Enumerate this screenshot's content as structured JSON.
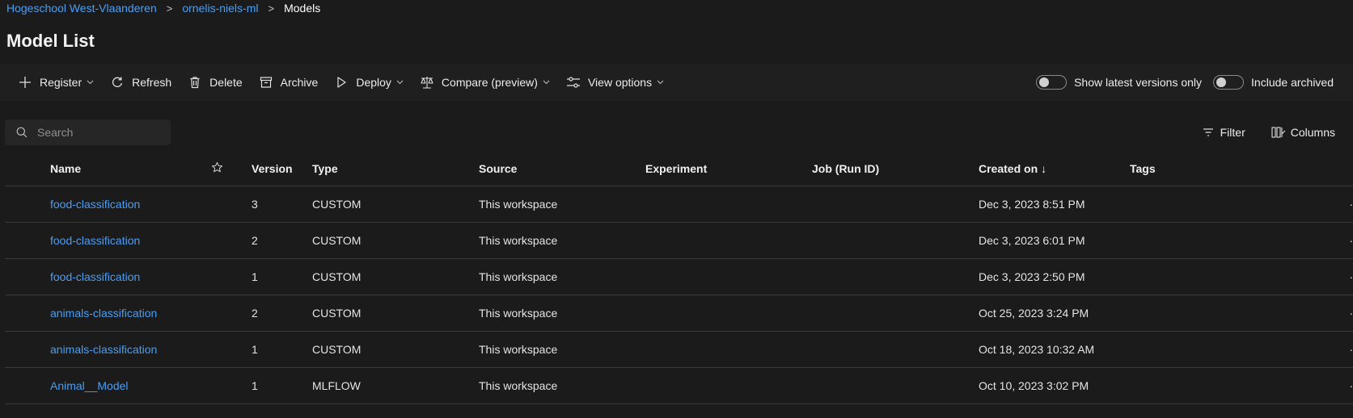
{
  "breadcrumb": {
    "items": [
      "Hogeschool West-Vlaanderen",
      "ornelis-niels-ml"
    ],
    "current": "Models",
    "separator": ">"
  },
  "page": {
    "title": "Model List"
  },
  "toolbar": {
    "register": "Register",
    "refresh": "Refresh",
    "delete": "Delete",
    "archive": "Archive",
    "deploy": "Deploy",
    "compare": "Compare (preview)",
    "view_options": "View options"
  },
  "toggles": {
    "latest_only": {
      "label": "Show latest versions only",
      "on": false
    },
    "include_archived": {
      "label": "Include archived",
      "on": false
    }
  },
  "search": {
    "placeholder": "Search",
    "value": ""
  },
  "tools": {
    "filter": "Filter",
    "columns": "Columns"
  },
  "table": {
    "headers": {
      "name": "Name",
      "version": "Version",
      "type": "Type",
      "source": "Source",
      "experiment": "Experiment",
      "job": "Job (Run ID)",
      "created": "Created on",
      "created_sort": "↓",
      "tags": "Tags"
    },
    "rows": [
      {
        "name": "food-classification",
        "version": "3",
        "type": "CUSTOM",
        "source": "This workspace",
        "experiment": "",
        "job": "",
        "created": "Dec 3, 2023 8:51 PM",
        "tags": "",
        "more": "·"
      },
      {
        "name": "food-classification",
        "version": "2",
        "type": "CUSTOM",
        "source": "This workspace",
        "experiment": "",
        "job": "",
        "created": "Dec 3, 2023 6:01 PM",
        "tags": "",
        "more": "·"
      },
      {
        "name": "food-classification",
        "version": "1",
        "type": "CUSTOM",
        "source": "This workspace",
        "experiment": "",
        "job": "",
        "created": "Dec 3, 2023 2:50 PM",
        "tags": "",
        "more": "·"
      },
      {
        "name": "animals-classification",
        "version": "2",
        "type": "CUSTOM",
        "source": "This workspace",
        "experiment": "",
        "job": "",
        "created": "Oct 25, 2023 3:24 PM",
        "tags": "",
        "more": "·"
      },
      {
        "name": "animals-classification",
        "version": "1",
        "type": "CUSTOM",
        "source": "This workspace",
        "experiment": "",
        "job": "",
        "created": "Oct 18, 2023 10:32 AM",
        "tags": "",
        "more": "·"
      },
      {
        "name": "Animal__Model",
        "version": "1",
        "type": "MLFLOW",
        "source": "This workspace",
        "experiment": "",
        "job": "",
        "created": "Oct 10, 2023 3:02 PM",
        "tags": "",
        "more": "·"
      }
    ]
  },
  "colors": {
    "background": "#1b1b1c",
    "toolbar": "#1f1f20",
    "link": "#479ef5",
    "divider": "#3a3a3b"
  }
}
